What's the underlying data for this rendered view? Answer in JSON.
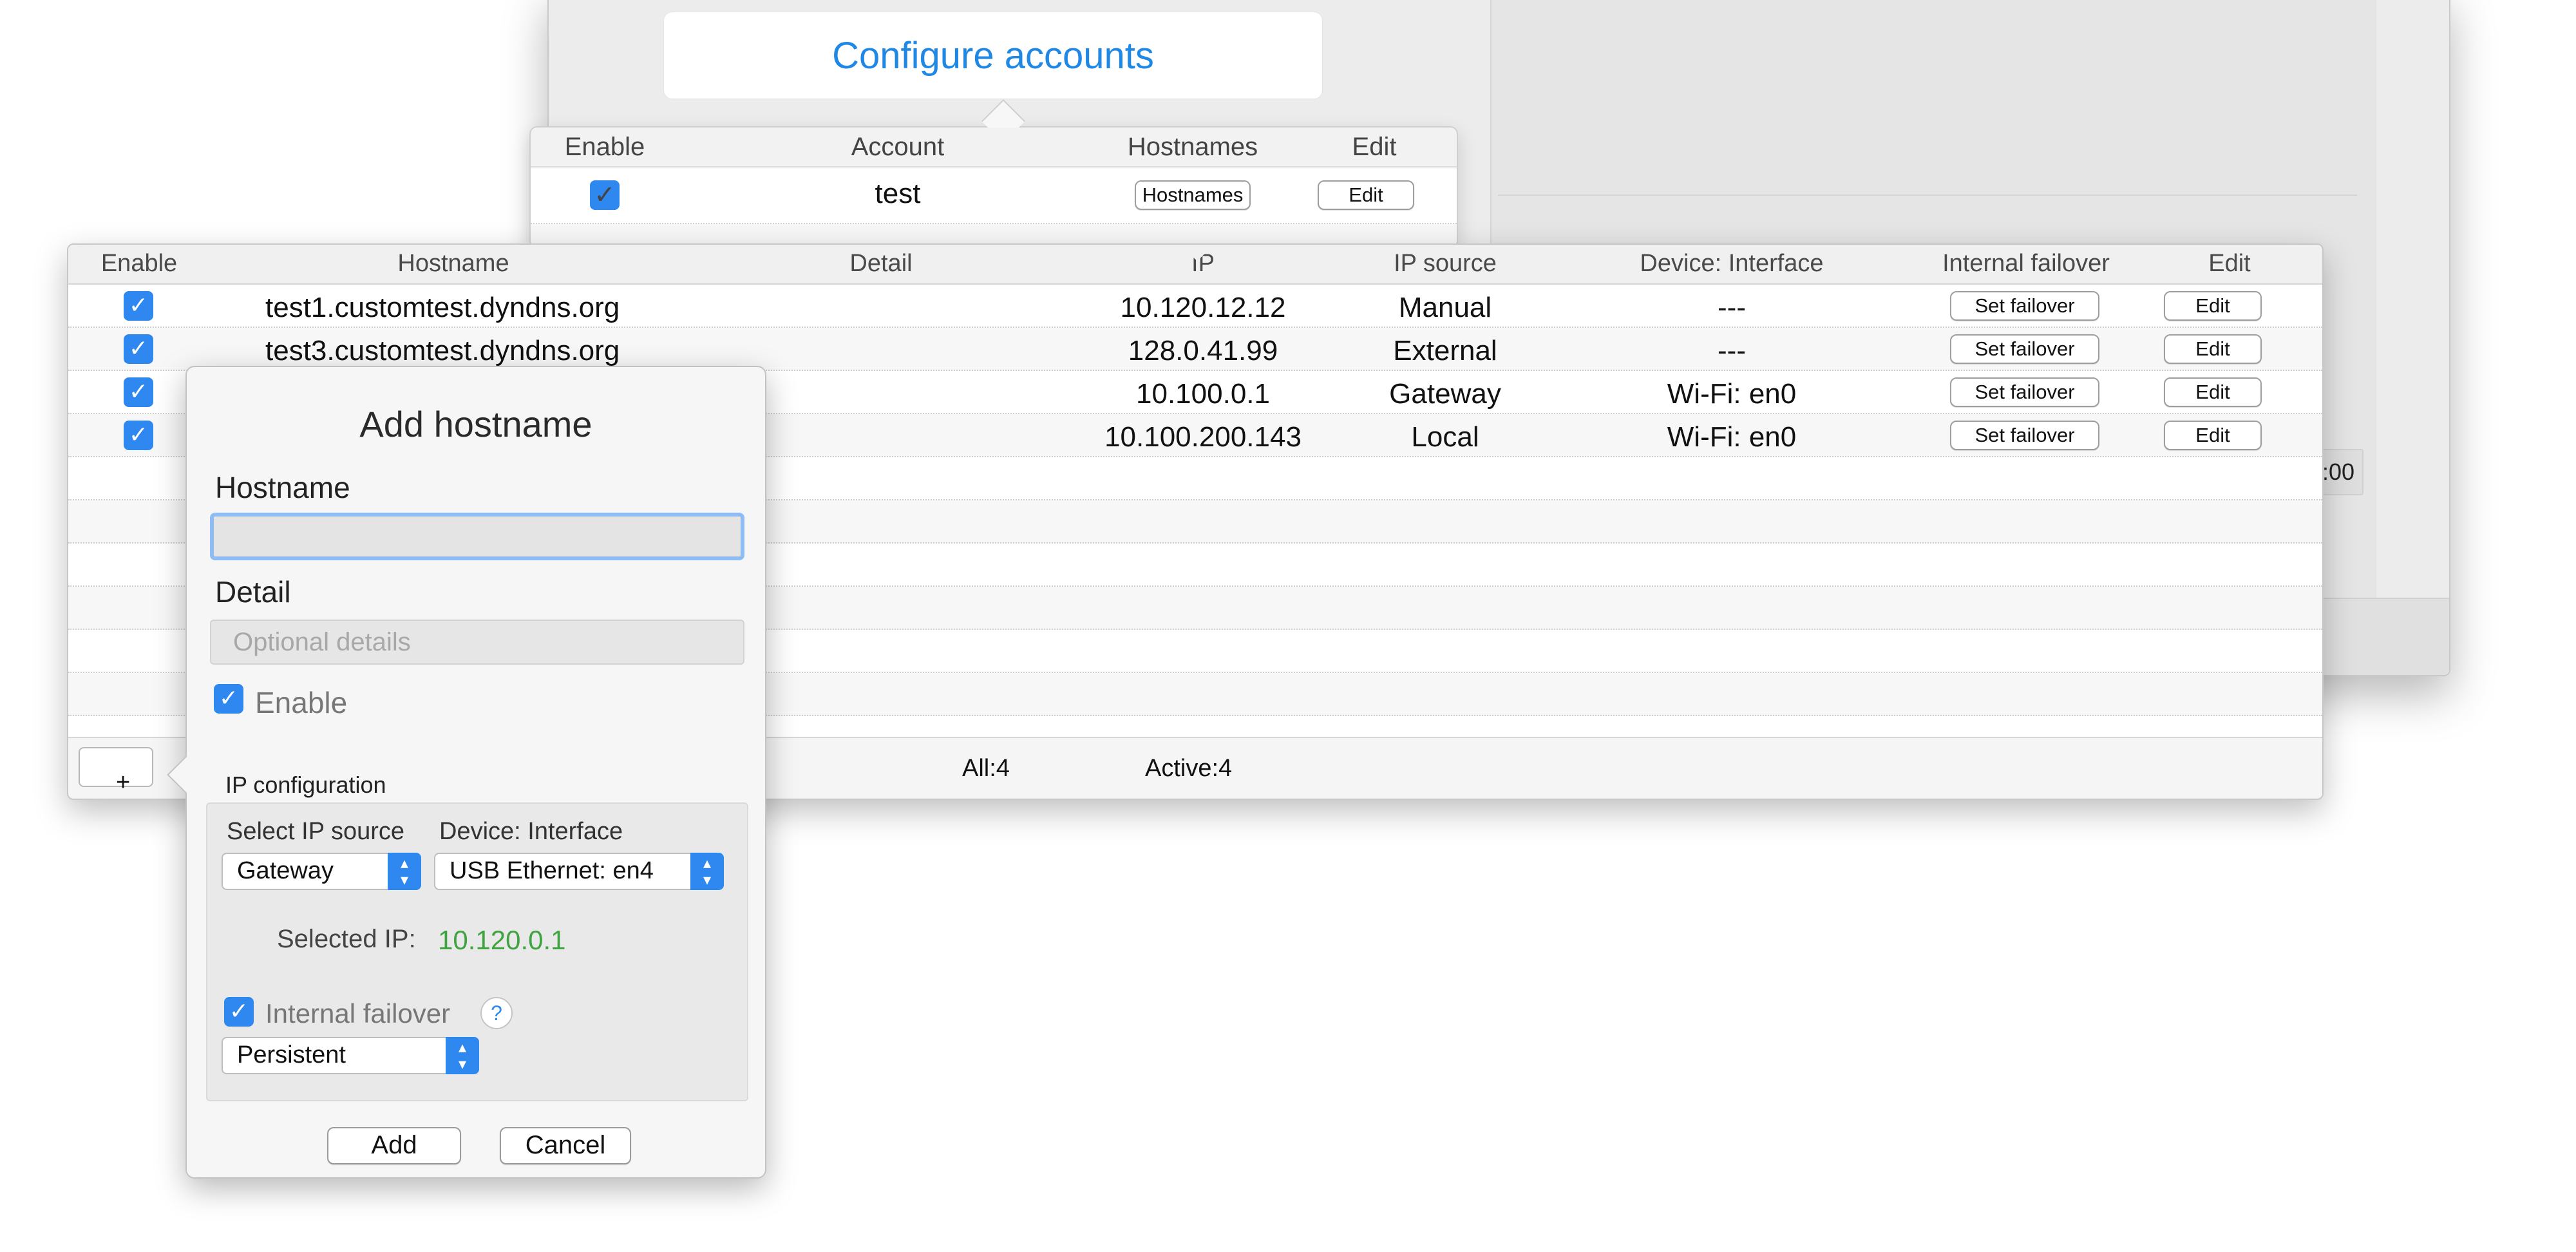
{
  "configure": {
    "label": "Configure accounts"
  },
  "accounts": {
    "headers": {
      "enable": "Enable",
      "account": "Account",
      "hostnames": "Hostnames",
      "edit": "Edit"
    },
    "rows": [
      {
        "account": "test",
        "hostnames_btn": "Hostnames",
        "edit_btn": "Edit"
      }
    ]
  },
  "hosts": {
    "headers": {
      "enable": "Enable",
      "hostname": "Hostname",
      "detail": "Detail",
      "ip": "IP",
      "ip_source": "IP source",
      "device": "Device: Interface",
      "failover": "Internal failover",
      "edit": "Edit"
    },
    "rows": [
      {
        "hostname": "test1.customtest.dyndns.org",
        "ip": "10.120.12.12",
        "source": "Manual",
        "device": "---",
        "failover_btn": "Set failover",
        "edit_btn": "Edit"
      },
      {
        "hostname": "test3.customtest.dyndns.org",
        "ip": "128.0.41.99",
        "source": "External",
        "device": "---",
        "failover_btn": "Set failover",
        "edit_btn": "Edit"
      },
      {
        "hostname": "",
        "ip": "10.100.0.1",
        "source": "Gateway",
        "device": "Wi-Fi: en0",
        "failover_btn": "Set failover",
        "edit_btn": "Edit"
      },
      {
        "hostname": "",
        "ip": "10.100.200.143",
        "source": "Local",
        "device": "Wi-Fi: en0",
        "failover_btn": "Set failover",
        "edit_btn": "Edit"
      }
    ],
    "footer": {
      "add": "+",
      "all": "All:4",
      "active": "Active:4"
    }
  },
  "background": {
    "time_fragment": ":00"
  },
  "add_dialog": {
    "title": "Add hostname",
    "hostname_label": "Hostname",
    "hostname_value": "",
    "detail_label": "Detail",
    "detail_placeholder": "Optional details",
    "enable_label": "Enable",
    "ip_config_title": "IP configuration",
    "ip_source_label": "Select IP source",
    "device_label": "Device: Interface",
    "ip_source_value": "Gateway",
    "device_value": "USB Ethernet: en4",
    "selected_ip_label": "Selected IP:",
    "selected_ip_value": "10.120.0.1",
    "failover_label": "Internal failover",
    "help": "?",
    "failover_mode": "Persistent",
    "add_btn": "Add",
    "cancel_btn": "Cancel"
  },
  "icons": {
    "check": "checkmark-icon",
    "stepper": "up-down-chevron-icon",
    "help": "question-icon",
    "plus": "plus-icon"
  },
  "colors": {
    "accent": "#2f88f0",
    "link": "#1f88e5",
    "selected_ip": "#3fa33f"
  }
}
